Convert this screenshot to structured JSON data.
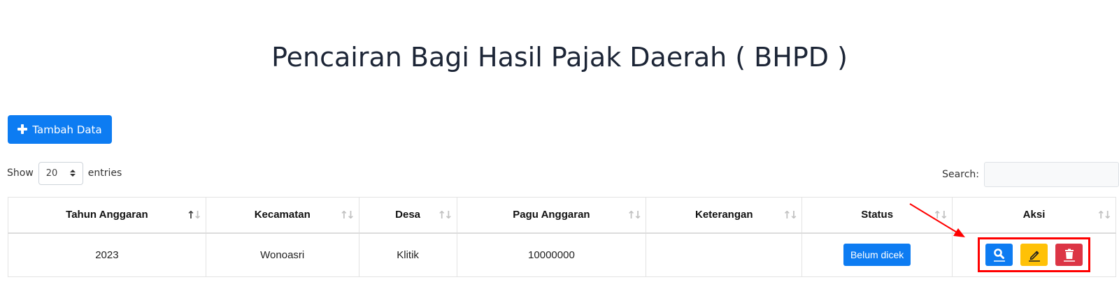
{
  "page": {
    "title": "Pencairan Bagi Hasil Pajak Daerah ( BHPD )"
  },
  "toolbar": {
    "add_label": "Tambah Data"
  },
  "length": {
    "show_label": "Show",
    "value": "20",
    "entries_label": "entries"
  },
  "search": {
    "label": "Search:",
    "value": ""
  },
  "table": {
    "columns": [
      "Tahun Anggaran",
      "Kecamatan",
      "Desa",
      "Pagu Anggaran",
      "Keterangan",
      "Status",
      "Aksi"
    ],
    "rows": [
      {
        "tahun": "2023",
        "kecamatan": "Wonoasri",
        "desa": "Klitik",
        "pagu": "10000000",
        "keterangan": "",
        "status": "Belum dicek"
      }
    ]
  },
  "colors": {
    "primary": "#0d7cf2",
    "warning": "#ffc107",
    "danger": "#dc3545",
    "highlight": "#ff0000"
  },
  "icons": {
    "view": "search-icon",
    "edit": "pencil-icon",
    "delete": "trash-icon",
    "add": "plus-icon"
  }
}
